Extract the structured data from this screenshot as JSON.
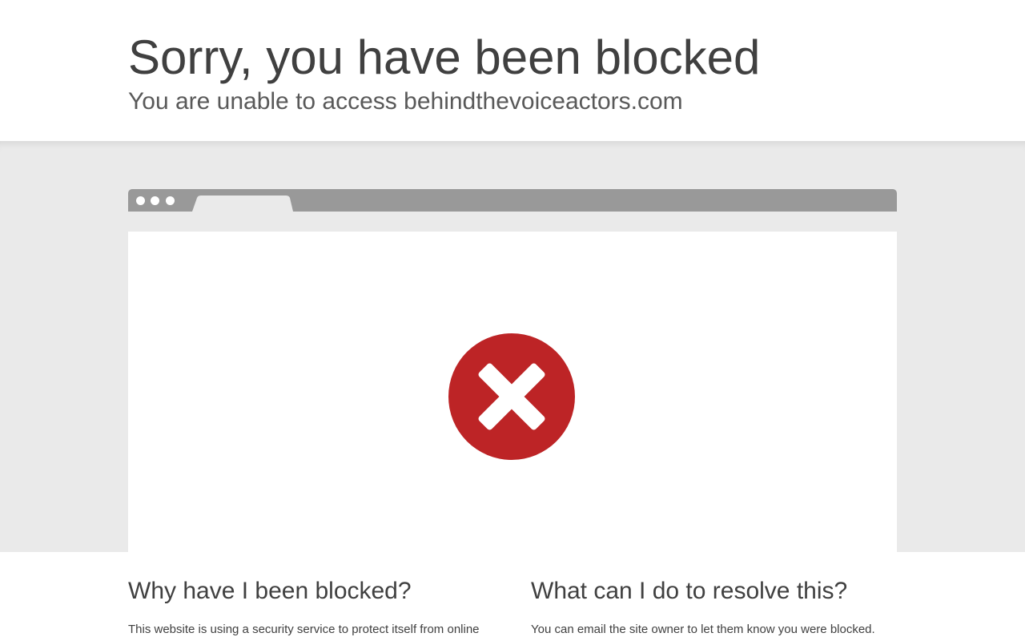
{
  "header": {
    "title": "Sorry, you have been blocked",
    "subtitle": "You are unable to access behindthevoiceactors.com"
  },
  "browser_illustration": {
    "status_icon": "error-x-circle-icon",
    "icon_color": "#bd2426"
  },
  "info": {
    "why": {
      "heading": "Why have I been blocked?",
      "body": "This website is using a security service to protect itself from online"
    },
    "resolve": {
      "heading": "What can I do to resolve this?",
      "body": "You can email the site owner to let them know you were blocked."
    }
  }
}
